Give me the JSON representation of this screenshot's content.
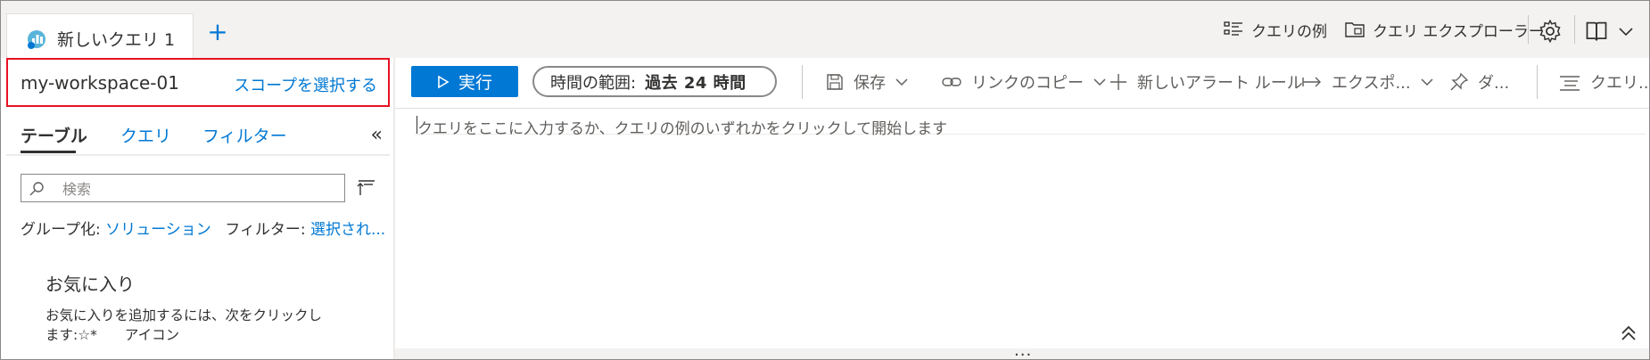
{
  "tab": {
    "title": "新しいクエリ 1",
    "add_label": "+"
  },
  "topbar": {
    "examples_label": "クエリの例",
    "explorer_label": "クエリ エクスプローラー"
  },
  "scope": {
    "workspace": "my-workspace-01",
    "select_label": "スコープを選択する"
  },
  "left_tabs": {
    "table": "テーブル",
    "query": "クエリ",
    "filter": "フィルター",
    "collapse": "«"
  },
  "search": {
    "placeholder": "検索"
  },
  "grouping": {
    "group_label": "グループ化:",
    "group_value": "ソリューション",
    "filter_label": "フィルター:",
    "filter_value": "選択され..."
  },
  "favorites": {
    "title": "お気に入り",
    "description": "お気に入りを追加するには、次をクリックし ます:☆*　　アイコン"
  },
  "toolbar": {
    "run_label": "実行",
    "time_range_label": "時間の範囲:",
    "time_range_value": "過去 24 時間",
    "save_label": "保存",
    "copy_link_label": "リンクのコピー",
    "new_alert_label": "新しいアラート ルール",
    "export_label": "エクスポ...",
    "pin_label": "ダ...",
    "format_label": "クエリ..."
  },
  "editor": {
    "placeholder": "クエリをここに入力するか、クエリの例のいずれかをクリックして開始します"
  },
  "splitter": {
    "label": "..."
  },
  "colors": {
    "accent": "#0078d4",
    "scope_highlight": "#e81123",
    "text": "#323130",
    "tab_strip_bg": "#f3f2f1"
  }
}
